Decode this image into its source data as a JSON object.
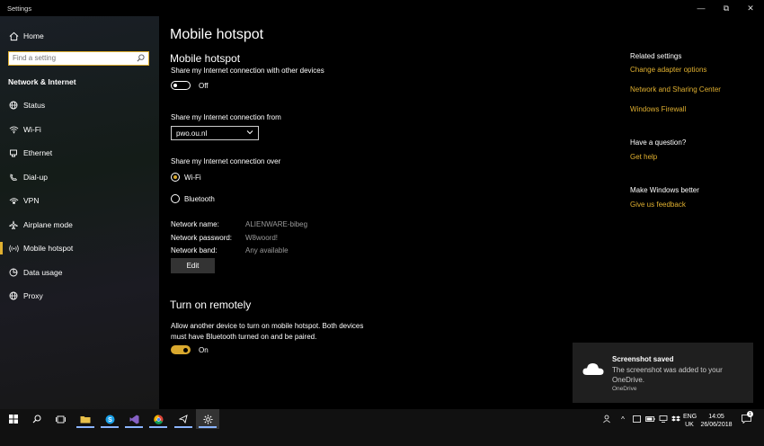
{
  "window": {
    "title": "Settings",
    "minimize_glyph": "—",
    "restore_glyph": "⧉",
    "close_glyph": "✕"
  },
  "sidebar": {
    "home_label": "Home",
    "search_placeholder": "Find a setting",
    "section_title": "Network & Internet",
    "items": [
      {
        "label": "Status",
        "icon": "globe-icon"
      },
      {
        "label": "Wi-Fi",
        "icon": "wifi-icon"
      },
      {
        "label": "Ethernet",
        "icon": "ethernet-icon"
      },
      {
        "label": "Dial-up",
        "icon": "dialup-icon"
      },
      {
        "label": "VPN",
        "icon": "vpn-icon"
      },
      {
        "label": "Airplane mode",
        "icon": "airplane-icon"
      },
      {
        "label": "Mobile hotspot",
        "icon": "hotspot-icon",
        "active": true
      },
      {
        "label": "Data usage",
        "icon": "data-usage-icon"
      },
      {
        "label": "Proxy",
        "icon": "globe-icon"
      }
    ]
  },
  "main": {
    "page_title": "Mobile hotspot",
    "hotspot": {
      "heading": "Mobile hotspot",
      "share_desc": "Share my Internet connection with other devices",
      "toggle_state": "Off"
    },
    "share_from": {
      "label": "Share my Internet connection from",
      "value": "pwo.ou.nl"
    },
    "share_over": {
      "label": "Share my Internet connection over",
      "options": [
        "Wi-Fi",
        "Bluetooth"
      ],
      "selected": "Wi-Fi"
    },
    "network": {
      "name_label": "Network name:",
      "name_value": "ALIENWARE-bibeg",
      "password_label": "Network password:",
      "password_value": "W8woord!",
      "band_label": "Network band:",
      "band_value": "Any available",
      "edit_label": "Edit"
    },
    "remote": {
      "heading": "Turn on remotely",
      "desc_line1": "Allow another device to turn on mobile hotspot. Both devices",
      "desc_line2": "must have Bluetooth turned on and be paired.",
      "toggle_state": "On"
    }
  },
  "related": {
    "heading": "Related settings",
    "links": [
      "Change adapter options",
      "Network and Sharing Center",
      "Windows Firewall"
    ],
    "question_heading": "Have a question?",
    "question_link": "Get help",
    "better_heading": "Make Windows better",
    "better_link": "Give us feedback"
  },
  "toast": {
    "title": "Screenshot saved",
    "body": "The screenshot was added to your OneDrive.",
    "source": "OneDrive"
  },
  "taskbar": {
    "language_line1": "ENG",
    "language_line2": "UK",
    "time": "14:05",
    "date": "26/06/2018",
    "notification_count": "1"
  },
  "colors": {
    "accent": "#e0b030",
    "toggle_on": "#d9a82e",
    "background": "#000000",
    "toast_bg": "#1f1f1f",
    "taskbar_bg": "#111111"
  }
}
